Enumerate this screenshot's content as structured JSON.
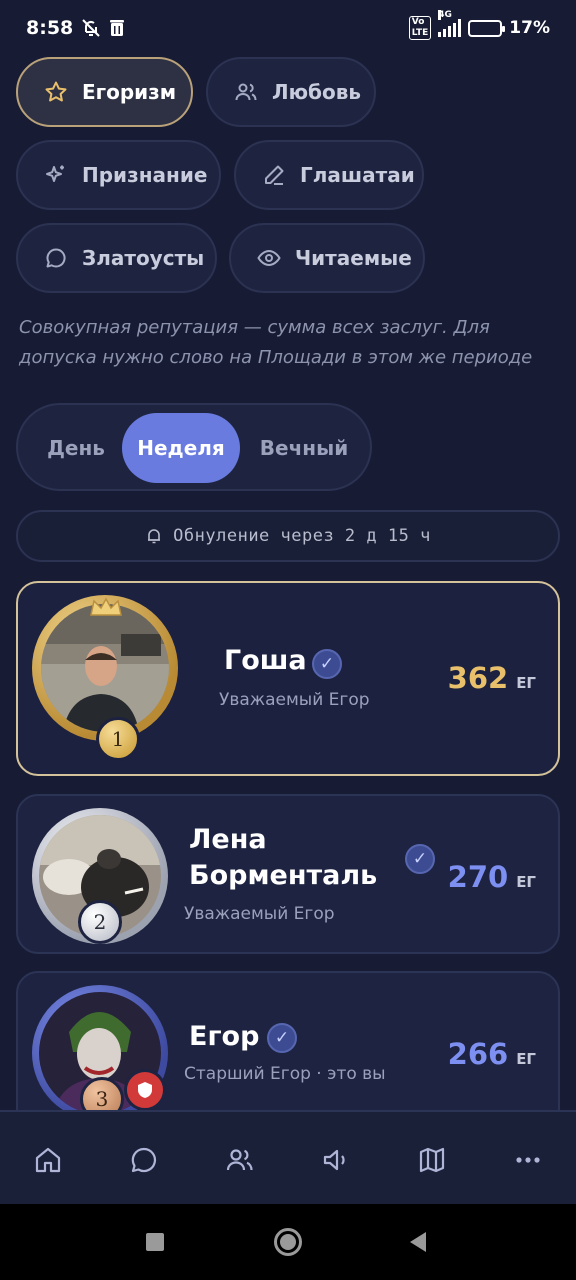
{
  "status_bar": {
    "time": "8:58",
    "battery": "17%",
    "network": "4G"
  },
  "categories": [
    {
      "label": "Егоризм",
      "icon": "star-icon",
      "active": true
    },
    {
      "label": "Любовь",
      "icon": "users-icon",
      "active": false
    },
    {
      "label": "Признание",
      "icon": "sparkle-icon",
      "active": false
    },
    {
      "label": "Глашатаи",
      "icon": "pencil-icon",
      "active": false
    },
    {
      "label": "Златоусты",
      "icon": "chat-bubble-icon",
      "active": false
    },
    {
      "label": "Читаемые",
      "icon": "eye-icon",
      "active": false
    }
  ],
  "description": "Совокупная репутация — сумма всех заслуг. Для допуска нужно слово на Площади в этом же периоде",
  "period_toggle": {
    "options": [
      "День",
      "Неделя",
      "Вечный"
    ],
    "selected": "Неделя"
  },
  "reset_notice": "Обнуление через 2 д 15 ч",
  "leaderboard": [
    {
      "rank": "1",
      "name": "Гоша",
      "role": "Уважаемый Егор",
      "score": "362",
      "unit": "ЕГ",
      "verified": true
    },
    {
      "rank": "2",
      "name": "Лена Борменталь",
      "role": "Уважаемый Егор",
      "score": "270",
      "unit": "ЕГ",
      "verified": true
    },
    {
      "rank": "3",
      "name": "Егор",
      "role": "Старший Егор · это вы",
      "score": "266",
      "unit": "ЕГ",
      "verified": true
    }
  ],
  "colors": {
    "background": "#171c34",
    "gold": "#e8c06c",
    "accent": "#6a7be0",
    "score_blue": "#7d8ff0"
  },
  "bottom_nav": [
    "home-icon",
    "chat-icon",
    "users-icon",
    "megaphone-icon",
    "map-icon",
    "more-icon"
  ],
  "system_nav": [
    "recents-button",
    "home-button",
    "back-button"
  ]
}
